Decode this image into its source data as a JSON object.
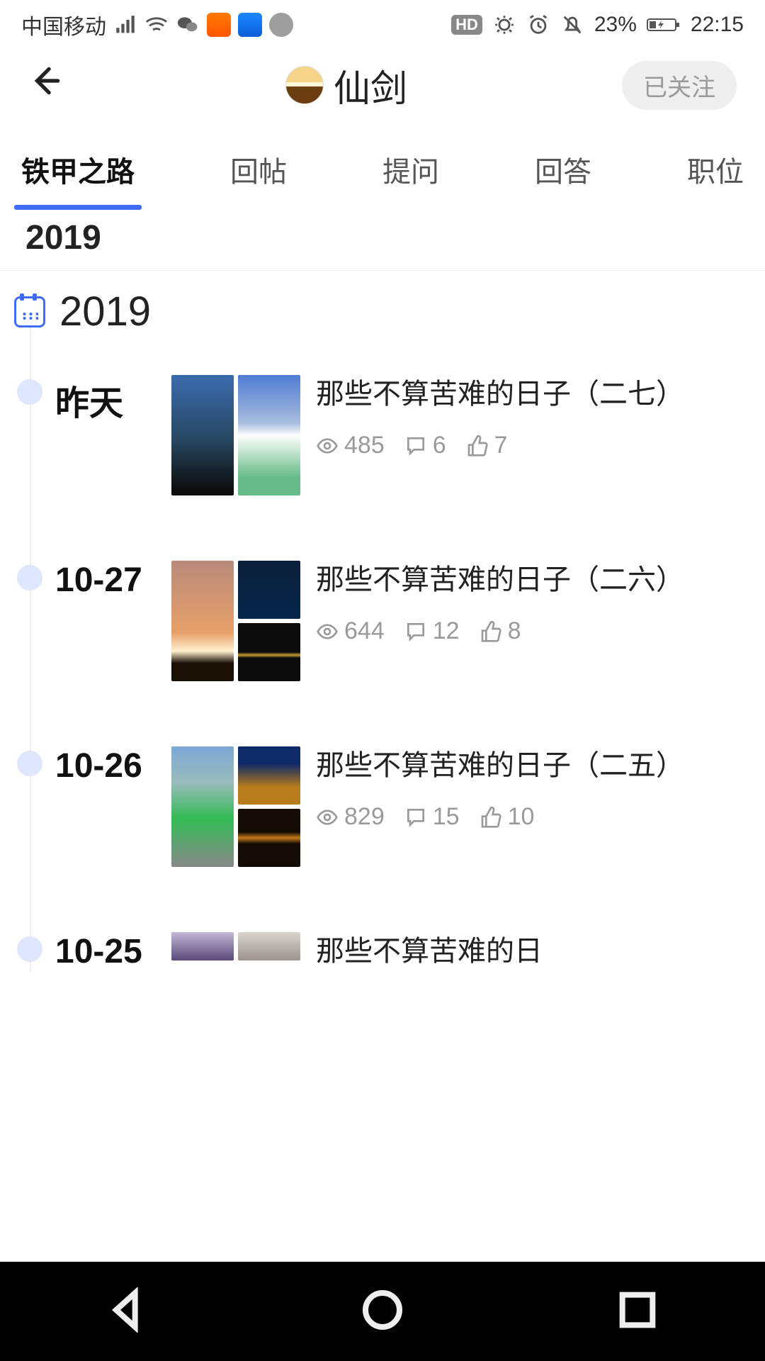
{
  "status": {
    "carrier": "中国移动",
    "battery_pct": "23%",
    "time": "22:15"
  },
  "header": {
    "title": "仙剑",
    "follow_state": "已关注"
  },
  "tabs": [
    "铁甲之路",
    "回帖",
    "提问",
    "回答",
    "职位"
  ],
  "active_tab_index": 0,
  "sticky_year": "2019",
  "year_head": "2019",
  "posts": [
    {
      "date": "昨天",
      "title": "那些不算苦难的日子（二七）",
      "views": "485",
      "comments": "6",
      "likes": "7"
    },
    {
      "date": "10-27",
      "title": "那些不算苦难的日子（二六）",
      "views": "644",
      "comments": "12",
      "likes": "8"
    },
    {
      "date": "10-26",
      "title": "那些不算苦难的日子（二五）",
      "views": "829",
      "comments": "15",
      "likes": "10"
    },
    {
      "date": "10-25",
      "title": "那些不算苦难的日",
      "views": "",
      "comments": "",
      "likes": ""
    }
  ]
}
